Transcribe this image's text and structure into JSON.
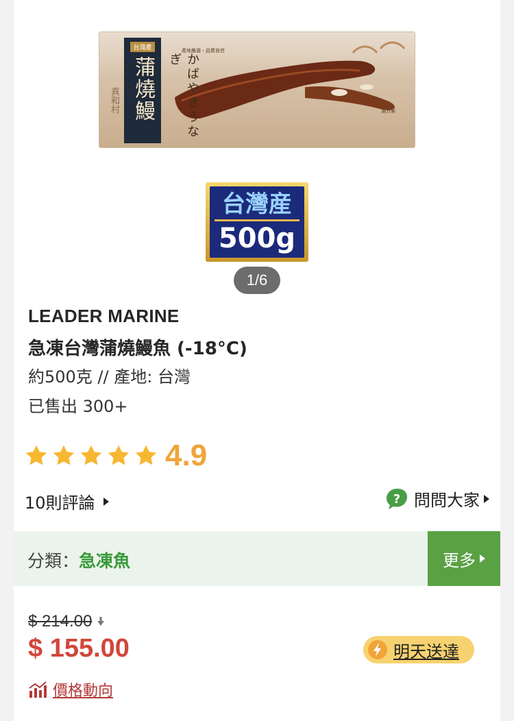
{
  "product": {
    "image": {
      "package_title": "蒲燒鰻",
      "package_tag": "台灣產",
      "package_side_text": "真和村",
      "package_kana": "かばやきうなぎ",
      "package_top_tag": "產地嚴選・品質自信",
      "package_right_tag": "濃方案"
    },
    "badge": {
      "top": "台灣産",
      "bottom": "500g"
    },
    "image_counter": "1/6",
    "brand": "LEADER MARINE",
    "name": "急凍台灣蒲燒鰻魚 (-18°C)",
    "spec": "約500克 // 產地: 台灣",
    "sold": "已售出 300+",
    "rating": {
      "stars": 5,
      "value": "4.9"
    },
    "reviews_link": "10則評論",
    "ask_link": "問問大家",
    "category": {
      "label": "分類：",
      "value": "急凍魚",
      "more": "更多"
    },
    "price": {
      "original": "$ 214.00",
      "current": "$ 155.00"
    },
    "delivery_label": "明天送達",
    "price_trend_link": "價格動向"
  },
  "colors": {
    "star": "#f7b731",
    "rating": "#f0a43a",
    "price": "#d0473a",
    "green": "#5aa144",
    "category_bg": "#ebf4ec",
    "delivery_bg": "#f7d270"
  },
  "icons": {
    "star": "star-icon",
    "ask": "question-bubble-icon",
    "delivery": "lightning-icon",
    "trend": "bar-chart-icon",
    "price_down": "down-arrow-icon"
  }
}
